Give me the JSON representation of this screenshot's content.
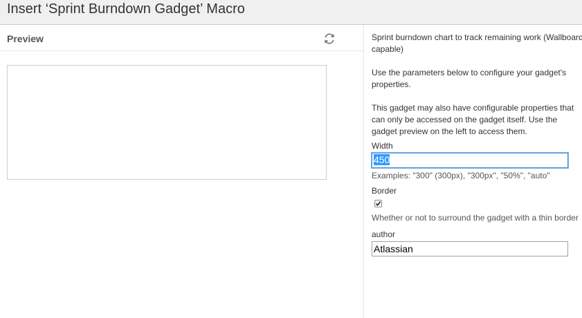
{
  "dialog": {
    "title": "Insert ‘Sprint Burndown Gadget’ Macro"
  },
  "preview": {
    "title": "Preview",
    "refresh_icon": "refresh-icon"
  },
  "params": {
    "description_lines": [
      "Sprint burndown chart to track remaining work (Wallboard",
      "capable)"
    ],
    "instruction_lines": [
      "Use the parameters below to configure your gadget's",
      "properties."
    ],
    "note_lines": [
      "This gadget may also have configurable properties that",
      "can only be accessed on the gadget itself. Use the",
      "gadget preview on the left to access them."
    ],
    "width": {
      "label": "Width",
      "value": "450",
      "help": "Examples: \"300\" (300px), \"300px\", \"50%\", \"auto\""
    },
    "border": {
      "label": "Border",
      "checked": true,
      "help": "Whether or not to surround the gadget with a thin border"
    },
    "author": {
      "label": "author",
      "value": "Atlassian"
    }
  },
  "colors": {
    "header_bg": "#f0f0f0",
    "focus_border": "#4a90d9",
    "selection": "#3399ff"
  }
}
